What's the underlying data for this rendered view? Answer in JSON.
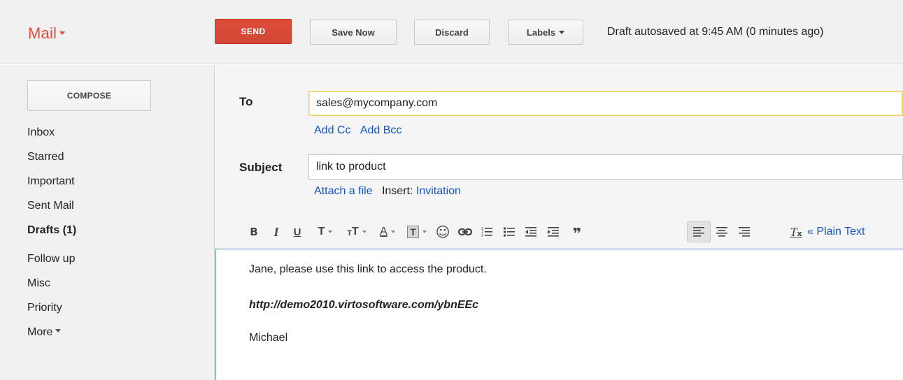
{
  "app": {
    "title": "Mail"
  },
  "toolbar": {
    "send_label": "SEND",
    "save_label": "Save Now",
    "discard_label": "Discard",
    "labels_label": "Labels",
    "autosave_text": "Draft autosaved at 9:45 AM (0 minutes ago)"
  },
  "sidebar": {
    "compose_label": "COMPOSE",
    "items": [
      {
        "label": "Inbox"
      },
      {
        "label": "Starred"
      },
      {
        "label": "Important"
      },
      {
        "label": "Sent Mail"
      },
      {
        "label": "Drafts (1)"
      },
      {
        "label": "Follow up"
      },
      {
        "label": "Misc"
      },
      {
        "label": "Priority"
      },
      {
        "label": "More"
      }
    ]
  },
  "compose": {
    "to_label": "To",
    "to_value": "sales@mycompany.com",
    "add_cc": "Add Cc",
    "add_bcc": "Add Bcc",
    "subject_label": "Subject",
    "subject_value": "link to product",
    "attach_file": "Attach a file",
    "insert_label": "Insert:",
    "invitation": "Invitation",
    "plain_text": "« Plain Text",
    "body": {
      "line1": "Jane, please use this link to access the product.",
      "url": "http://demo2010.virtosoftware.com/ybnEEc",
      "signature": "Michael"
    }
  },
  "format_tools": {
    "bold": "B",
    "italic": "I",
    "underline": "U",
    "font": "T",
    "size": "T",
    "text_color": "A",
    "highlight": "T",
    "emoji": "☺"
  },
  "colors": {
    "brand_red": "#dd4b39",
    "link_blue": "#1155cc",
    "focus_yellow": "#f0d050",
    "editor_border": "#5b86d6"
  }
}
